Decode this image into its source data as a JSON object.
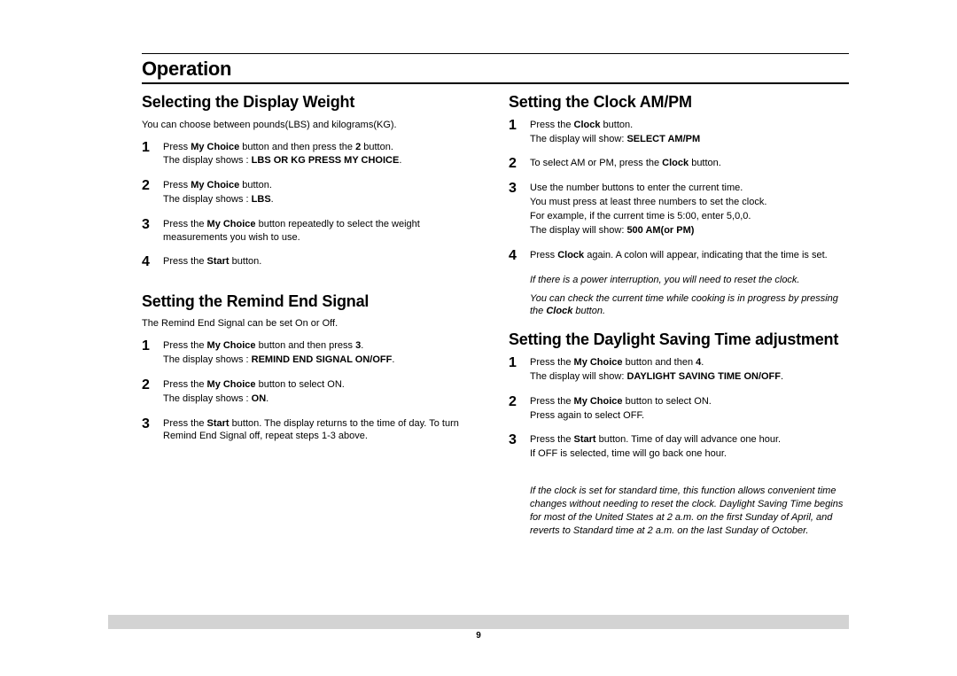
{
  "page": {
    "header": "Operation",
    "number": "9"
  },
  "left": {
    "sec1": {
      "title": "Selecting the Display Weight",
      "intro": "You can choose between pounds(LBS) and kilograms(KG).",
      "s1": {
        "n": "1",
        "a": "Press ",
        "b": "My Choice",
        "c": " button and then press the ",
        "d": "2",
        "e": " button.",
        "f": "The display shows : ",
        "g": "LBS OR KG PRESS MY CHOICE",
        "h": "."
      },
      "s2": {
        "n": "2",
        "a": "Press ",
        "b": "My Choice",
        "c": " button.",
        "d": "The display shows : ",
        "e": "LBS",
        "f": "."
      },
      "s3": {
        "n": "3",
        "a": "Press the ",
        "b": "My Choice",
        "c": " button repeatedly to select the weight measurements you wish to use."
      },
      "s4": {
        "n": "4",
        "a": "Press the ",
        "b": "Start",
        "c": " button."
      }
    },
    "sec2": {
      "title": "Setting the Remind End Signal",
      "intro": "The Remind End Signal can be set On or Off.",
      "s1": {
        "n": "1",
        "a": "Press the ",
        "b": "My Choice",
        "c": " button and then press ",
        "d": "3",
        "e": ".",
        "f": "The display shows : ",
        "g": "REMIND END SIGNAL ON/OFF",
        "h": "."
      },
      "s2": {
        "n": "2",
        "a": "Press the ",
        "b": "My Choice",
        "c": " button to select ON.",
        "d": "The display shows : ",
        "e": "ON",
        "f": "."
      },
      "s3": {
        "n": "3",
        "a": "Press the ",
        "b": "Start",
        "c": " button. The display returns to the time of day. To turn Remind End Signal off, repeat steps 1-3 above."
      }
    }
  },
  "right": {
    "sec1": {
      "title": "Setting the Clock AM/PM",
      "s1": {
        "n": "1",
        "a": "Press the ",
        "b": "Clock",
        "c": " button.",
        "d": "The display will show: ",
        "e": "SELECT AM/PM"
      },
      "s2": {
        "n": "2",
        "a": "To select AM or PM, press the ",
        "b": "Clock",
        "c": " button."
      },
      "s3": {
        "n": "3",
        "a": "Use the number buttons to enter the current time.",
        "b": "You must press at least three numbers to set the clock.",
        "c": "For example, if the current time is 5:00, enter 5,0,0.",
        "d": "The display will show: ",
        "e": "500 AM(or PM)"
      },
      "s4": {
        "n": "4",
        "a": "Press ",
        "b": "Clock",
        "c": " again. A colon will appear, indicating that the time is set."
      },
      "note1": "If there is a power interruption, you will need to reset the clock.",
      "note2a": "You can check the current time while cooking is in progress by pressing the ",
      "note2b": "Clock",
      "note2c": " button."
    },
    "sec2": {
      "title": "Setting the Daylight Saving Time adjustment",
      "s1": {
        "n": "1",
        "a": "Press the ",
        "b": "My Choice",
        "c": " button and then ",
        "d": "4",
        "e": ".",
        "f": "The display will show: ",
        "g": "DAYLIGHT SAVING TIME ON/OFF",
        "h": "."
      },
      "s2": {
        "n": "2",
        "a": "Press the ",
        "b": "My Choice",
        "c": " button to select ON.",
        "d": "Press again to select OFF."
      },
      "s3": {
        "n": "3",
        "a": "Press the ",
        "b": "Start",
        "c": " button. Time of day will advance one hour.",
        "d": "If OFF is selected, time will go back one hour."
      },
      "note": "If the clock is set for standard time, this function allows convenient time changes without needing to reset the clock. Daylight Saving Time begins for most of the United States at 2 a.m. on the first Sunday of April, and reverts to Standard time at 2 a.m. on the last Sunday of October."
    }
  }
}
